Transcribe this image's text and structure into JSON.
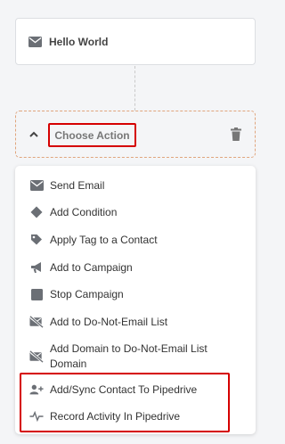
{
  "top_card": {
    "title": "Hello World",
    "icon": "envelope-icon"
  },
  "step": {
    "label": "Choose Action",
    "toggle_icon": "chevron-up-icon",
    "delete_icon": "trash-icon"
  },
  "menu": {
    "items": [
      {
        "label": "Send Email",
        "icon": "envelope-icon"
      },
      {
        "label": "Add Condition",
        "icon": "diamond-icon"
      },
      {
        "label": "Apply Tag to a Contact",
        "icon": "tag-icon"
      },
      {
        "label": "Add to Campaign",
        "icon": "megaphone-icon"
      },
      {
        "label": "Stop Campaign",
        "icon": "stop-icon"
      },
      {
        "label": "Add to Do-Not-Email List",
        "icon": "mail-blocked-icon"
      },
      {
        "label": "Add Domain to Do-Not-Email List Domain",
        "icon": "mail-blocked-icon"
      },
      {
        "label": "Add/Sync Contact To Pipedrive",
        "icon": "add-user-icon"
      },
      {
        "label": "Record Activity In Pipedrive",
        "icon": "pulse-icon"
      }
    ]
  },
  "colors": {
    "highlight": "#d50000",
    "dashed_border": "#e0a57d",
    "icon": "#6b6f75"
  }
}
